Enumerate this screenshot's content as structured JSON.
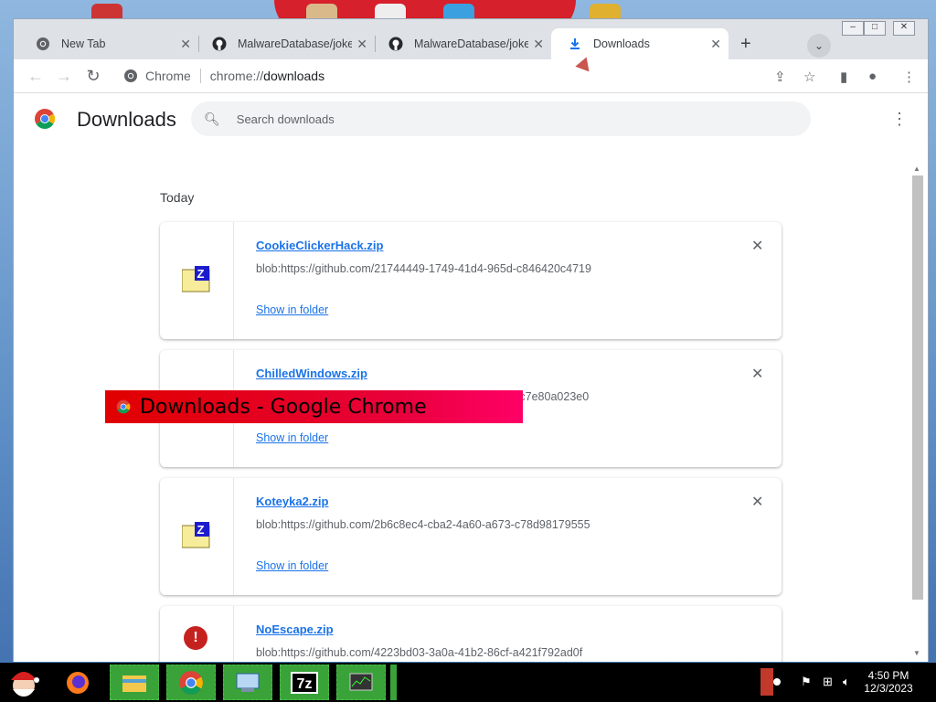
{
  "browser": {
    "tabs": [
      {
        "title": "New Tab",
        "icon": "chrome-icon",
        "active": false
      },
      {
        "title": "MalwareDatabase/jokes",
        "icon": "github-icon",
        "active": false
      },
      {
        "title": "MalwareDatabase/jokes",
        "icon": "github-icon",
        "active": false
      },
      {
        "title": "Downloads",
        "icon": "download-icon",
        "active": true
      }
    ],
    "omnibox": {
      "origin": "Chrome",
      "url_scheme": "chrome://",
      "url_path": "downloads"
    }
  },
  "page": {
    "title": "Downloads",
    "search_placeholder": "Search downloads",
    "section_date": "Today",
    "downloads": [
      {
        "name": "CookieClickerHack.zip",
        "url": "blob:https://github.com/21744449-1749-41d4-965d-c846420c4719",
        "action": "Show in folder",
        "icon": "zip-file-icon"
      },
      {
        "name": "ChilledWindows.zip",
        "url": "blob:https://github.com/147030ee-955f-4e4d-9364-0c7e80a023e0",
        "action": "Show in folder",
        "icon": "zip-file-icon"
      },
      {
        "name": "Koteyka2.zip",
        "url": "blob:https://github.com/2b6c8ec4-cba2-4a60-a673-c78d98179555",
        "action": "Show in folder",
        "icon": "zip-file-icon"
      },
      {
        "name": "NoEscape.zip",
        "url": "blob:https://github.com/4223bd03-3a0a-41b2-86cf-a421f792ad0f",
        "icon": "error-icon"
      }
    ]
  },
  "overlay": {
    "title": "Downloads - Google Chrome"
  },
  "taskbar": {
    "clock_time": "4:50 PM",
    "clock_date": "12/3/2023",
    "apps": [
      "firefox-icon",
      "file-explorer-icon",
      "chrome-icon",
      "control-panel-icon",
      "7zip-icon",
      "task-manager-icon"
    ],
    "app_7z_label": "7z"
  },
  "colors": {
    "link": "#1a73e8",
    "banner": "#e8003a",
    "taskbar_app": "#39a339"
  }
}
